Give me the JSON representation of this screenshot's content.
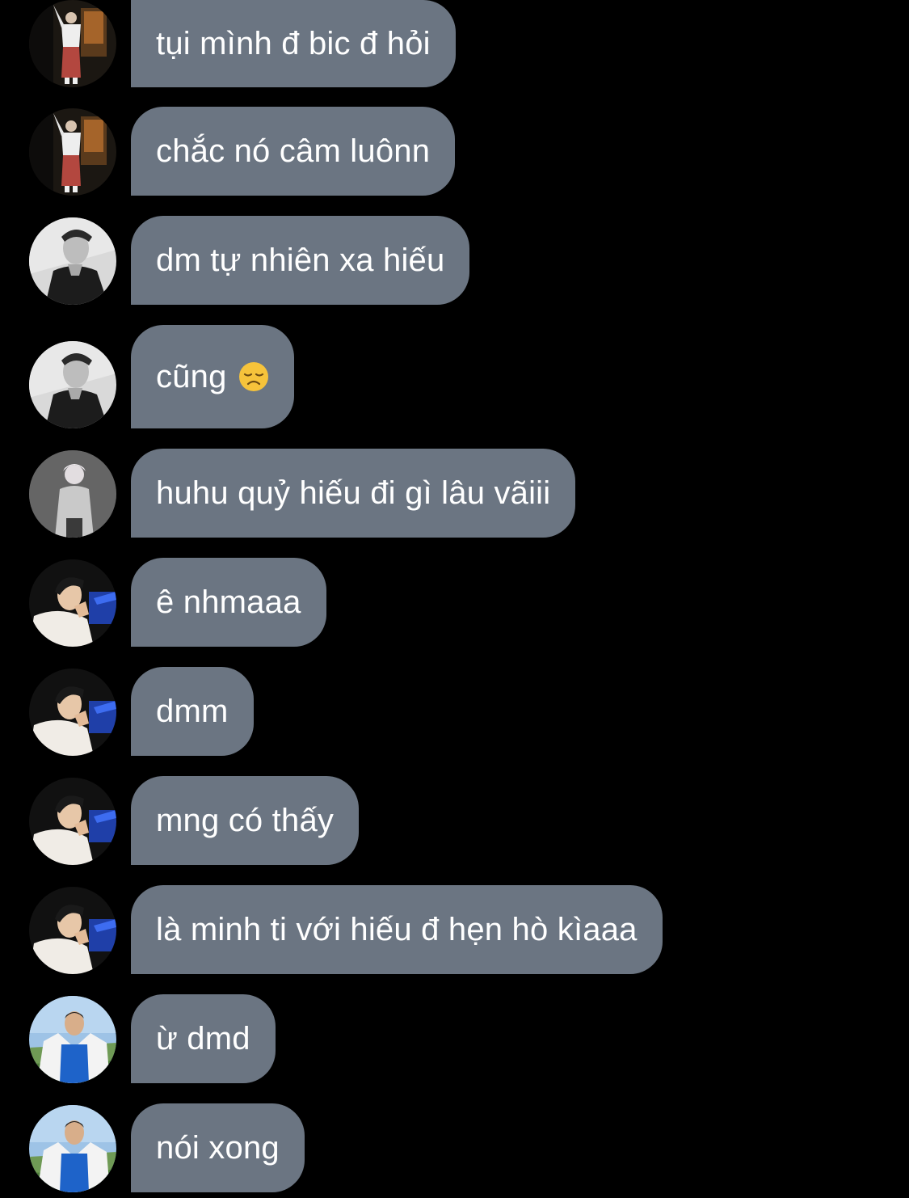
{
  "messages": [
    {
      "text": "tụi mình đ bic đ hỏi",
      "avatar": "user-a-avatar",
      "emoji": ""
    },
    {
      "text": "chắc nó câm luônn",
      "avatar": "user-a-avatar",
      "emoji": ""
    },
    {
      "text": "dm tự nhiên xa hiếu",
      "avatar": "user-b-avatar",
      "emoji": ""
    },
    {
      "text": "cũng",
      "avatar": "user-b-avatar",
      "emoji": "disappointed-face-emoji"
    },
    {
      "text": "huhu quỷ hiếu đi gì lâu vãiii",
      "avatar": "user-c-avatar",
      "emoji": ""
    },
    {
      "text": "ê nhmaaa",
      "avatar": "user-d-avatar",
      "emoji": ""
    },
    {
      "text": "dmm",
      "avatar": "user-d-avatar",
      "emoji": ""
    },
    {
      "text": "mng có thấy",
      "avatar": "user-d-avatar",
      "emoji": ""
    },
    {
      "text": "là minh ti với hiếu đ hẹn hò kìaaa",
      "avatar": "user-d-avatar",
      "emoji": ""
    },
    {
      "text": "ừ dmd",
      "avatar": "user-e-avatar",
      "emoji": ""
    },
    {
      "text": "nói xong",
      "avatar": "user-e-avatar",
      "emoji": ""
    }
  ],
  "colors": {
    "background": "#000000",
    "bubble": "#6b7582",
    "text": "#ffffff"
  }
}
